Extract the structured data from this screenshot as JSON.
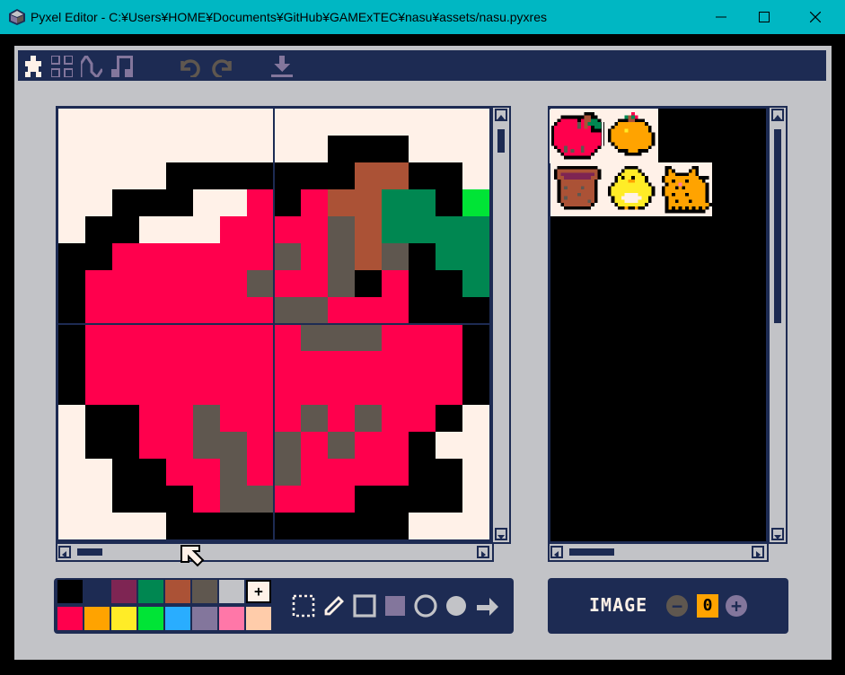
{
  "window": {
    "title": "Pyxel Editor - C:¥Users¥HOME¥Documents¥GitHub¥GAMExTEC¥nasu¥assets/nasu.pyxres",
    "minimize_glyph": "—",
    "maximize_glyph": "☐",
    "close_glyph": "✕"
  },
  "toolbar": {
    "icons": [
      "image-editor-icon",
      "tilemap-editor-icon",
      "sound-editor-icon",
      "music-editor-icon",
      "undo-icon",
      "redo-icon",
      "export-icon"
    ]
  },
  "palette": {
    "colors": [
      "#000000",
      "#1d2b53",
      "#7e2553",
      "#008751",
      "#ab5236",
      "#5f574f",
      "#c2c3c7",
      "#fff1e8",
      "#ff004d",
      "#ffa300",
      "#ffec27",
      "#00e436",
      "#29adff",
      "#83769c",
      "#ff77a8",
      "#ffccaa"
    ],
    "selected_index": 7,
    "selected_marker": "+"
  },
  "tools": [
    "select-tool-icon",
    "pencil-tool-icon",
    "rect-tool-icon",
    "filled-rect-tool-icon",
    "circle-tool-icon",
    "filled-circle-tool-icon",
    "fill-tool-icon"
  ],
  "image_panel": {
    "label": "IMAGE",
    "number": "0",
    "minus": "−",
    "plus": "+"
  },
  "canvas": {
    "grid_size": 16,
    "colors_used": {
      "0": "#000000",
      "4": "#ab5236",
      "5": "#5f574f",
      "3": "#008751",
      "7": "#fff1e8",
      "8": "#ff004d",
      "11": "#00e436"
    }
  },
  "preview": {
    "sprites": [
      "apple-sprite",
      "orange-sprite",
      "basket-sprite",
      "chick-sprite",
      "cat-sprite"
    ],
    "selected": "apple-sprite"
  }
}
